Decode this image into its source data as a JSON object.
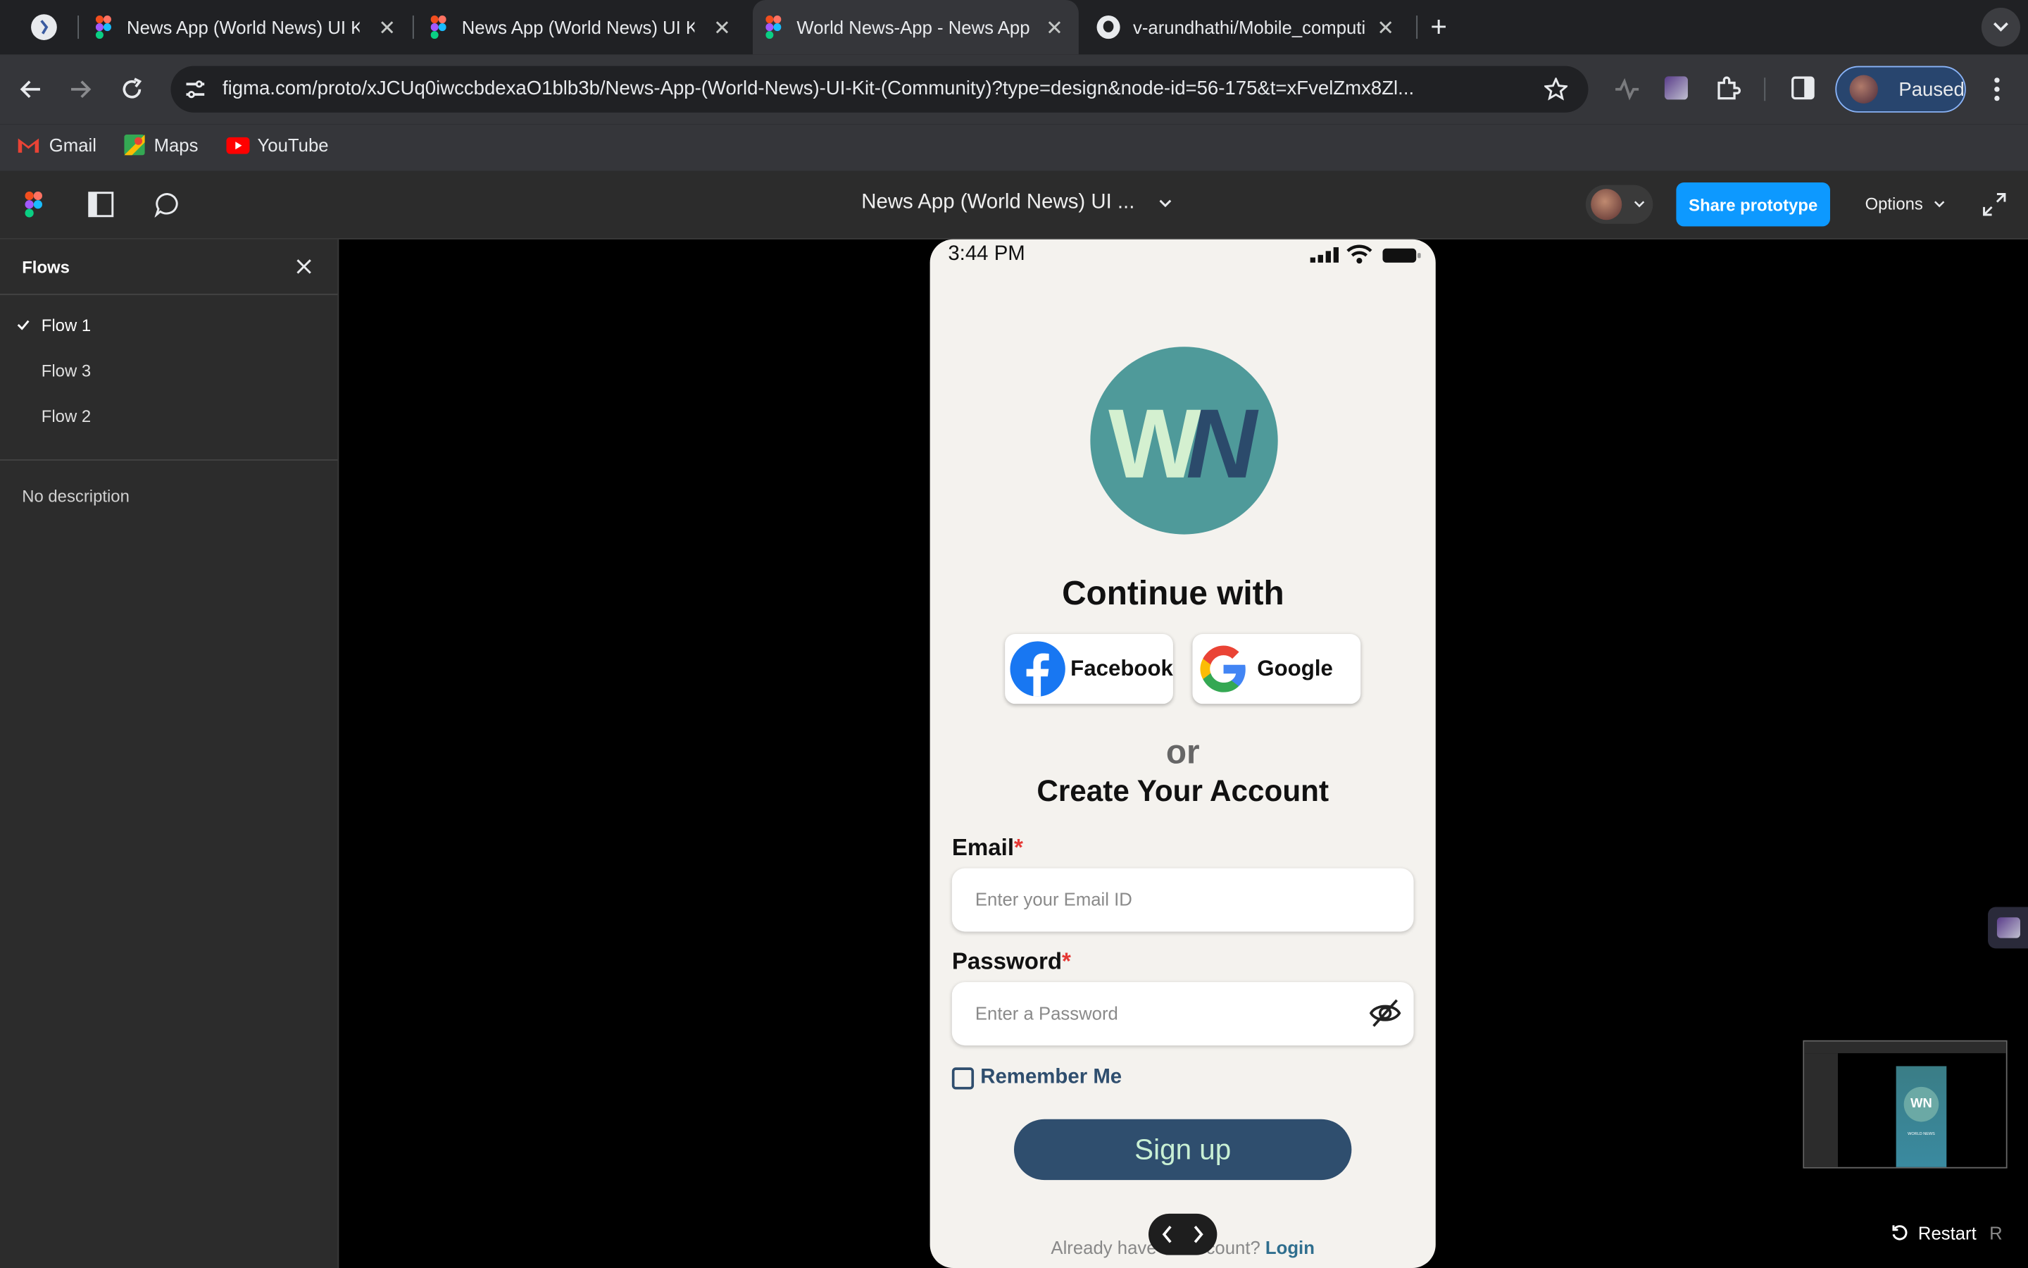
{
  "browser": {
    "tabs": [
      {
        "title": "News App (World News) UI Ki",
        "active": false
      },
      {
        "title": "News App (World News) UI Ki",
        "active": false
      },
      {
        "title": "World News-App - News App",
        "active": true
      },
      {
        "title": "v-arundhathi/Mobile_computi",
        "active": false
      }
    ],
    "new_tab": "+",
    "url": "figma.com/proto/xJCUq0iwccbdexaO1blb3b/News-App-(World-News)-UI-Kit-(Community)?type=design&node-id=56-175&t=xFvelZmx8Zl...",
    "profile_label": "Paused",
    "bookmarks": [
      "Gmail",
      "Maps",
      "YouTube"
    ]
  },
  "figma": {
    "file_title": "News App (World News) UI ...",
    "share_label": "Share prototype",
    "options_label": "Options",
    "sidebar": {
      "title": "Flows",
      "flows": [
        {
          "label": "Flow 1",
          "selected": true
        },
        {
          "label": "Flow 3",
          "selected": false
        },
        {
          "label": "Flow 2",
          "selected": false
        }
      ],
      "description": "No description"
    },
    "restart_label": "Restart",
    "restart_key": "R"
  },
  "phone": {
    "status_time": "3:44 PM",
    "logo_text_w": "W",
    "logo_text_n": "N",
    "continue_with": "Continue with",
    "facebook_label": "Facebook",
    "google_label": "Google",
    "or_label": "or",
    "create_account": "Create Your Account",
    "email_label": "Email",
    "required_mark": "*",
    "email_placeholder": "Enter your Email ID",
    "password_label": "Password",
    "password_placeholder": "Enter a Password",
    "remember_me": "Remember Me",
    "signup_label": "Sign up",
    "already_text": "Already have an account?",
    "login_label": "Login"
  },
  "minimap": {
    "logo_text": "WN",
    "caption": "WORLD NEWS"
  },
  "colors": {
    "accent_blue": "#0d99ff",
    "logo_teal": "#4f9a9a",
    "logo_light": "#d4f0d0",
    "logo_dark": "#2b4a6b",
    "signup_bg": "#2f4e6e",
    "signup_text": "#c9f0d4",
    "required_red": "#e53935"
  }
}
